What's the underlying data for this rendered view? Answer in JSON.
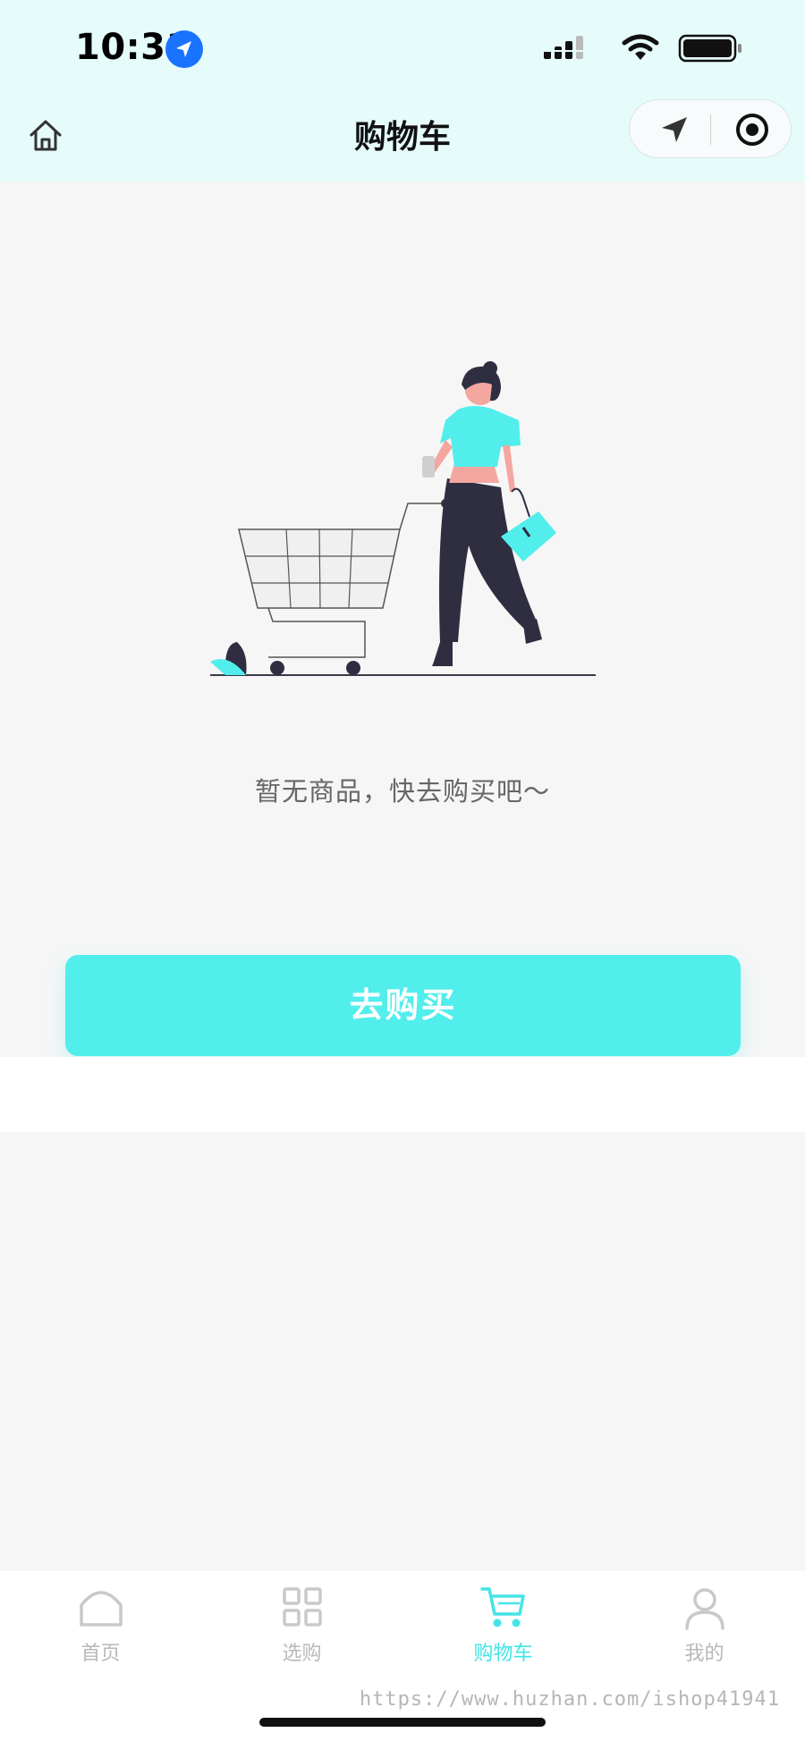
{
  "status_bar": {
    "time": "10:31"
  },
  "nav": {
    "title": "购物车",
    "home_icon": "home-icon",
    "capsule_icons": [
      "location-arrow-icon",
      "target-icon"
    ]
  },
  "empty_state": {
    "message": "暂无商品，快去购买吧～",
    "button_label": "去购买"
  },
  "tabs": [
    {
      "label": "首页",
      "icon": "home-outline-icon",
      "active": false
    },
    {
      "label": "选购",
      "icon": "grid-icon",
      "active": false
    },
    {
      "label": "购物车",
      "icon": "cart-icon",
      "active": true
    },
    {
      "label": "我的",
      "icon": "user-icon",
      "active": false
    }
  ],
  "watermark": "https://www.huzhan.com/ishop41941",
  "colors": {
    "accent": "#51eeec",
    "header_bg": "#e6fcfb",
    "page_bg": "#f6f6f6",
    "tab_inactive": "#b8b8b8",
    "tab_active": "#3ee6e6"
  }
}
